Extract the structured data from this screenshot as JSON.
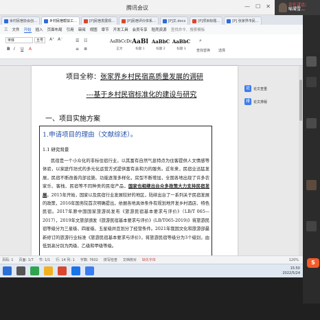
{
  "meeting": {
    "title": "腾讯会议",
    "share_status": "正在讲话：",
    "share_status_2": "喻凝雪…"
  },
  "doc_tabs": [
    {
      "label": "余村民宿协会创…"
    },
    {
      "label": "乡村民宿帮扶工…"
    },
    {
      "label": "[P]民宿发展现…"
    },
    {
      "label": "[P]民宿评价体系…"
    },
    {
      "label": "[P]文.docx"
    },
    {
      "label": "[P]项目标题…"
    },
    {
      "label": "[P] 张家界市民…"
    }
  ],
  "menu": [
    "三",
    "文件",
    "开始",
    "插入",
    "页面布局",
    "引用",
    "审阅",
    "视图",
    "章节",
    "开发工具",
    "会员专享",
    "稻壳资源",
    "查找命令、搜索模板"
  ],
  "menu_active": "开始",
  "toolbar": {
    "font_name": "宋体",
    "font_size": "五号",
    "styles": [
      {
        "sample": "AaBbCcDc",
        "label": "正文"
      },
      {
        "sample": "AaBl",
        "label": "标题 1"
      },
      {
        "sample": "AaBbC",
        "label": "标题 2"
      },
      {
        "sample": "AaBbC",
        "label": "标题 3"
      }
    ],
    "find_label": "查找替换",
    "select_label": "选择"
  },
  "side_panel": [
    {
      "icon": "论",
      "label": "论文查重"
    },
    {
      "icon": "排",
      "label": "论文排版"
    }
  ],
  "document": {
    "title_prefix": "项目全称：",
    "title_main": "张家界乡村民宿高质量发展的调研",
    "title_sub": "---基于乡村民宿标准化的建设与研究",
    "section_heading": "一、项目实施方案",
    "box_heading": "1.申请项目的理由（文献综述）。",
    "box_subheading": "1.1 研究背景",
    "para_part1": "民宿是一个小众化的非标住宿行业，以其富有自然气息特点为住客提供人文情感等体验，以家庭作坊式的多元化运营方式提供富有亲和力的服务。近年来，民宿业迅猛发展，民宿不断改善内部设施、功能逐渐多样化，房型不断增加，全国各地出现了许多农家乐、客栈、民宿等不同种类的民宿产品，",
    "para_bold": "国家也相继出台众多政策大力支持民宿发展",
    "para_part2": "。2015年开始，国家以及民宿行业发展较好的地区，陆续出台了一系列关于民宿发展的政策，2016年国务院首次明确提出，依据各地具体条件有规划地开发乡村酒店、特色民宿。2017年原中国国家旅游局发布《旅游民宿基本要求与评价》（LB/T 065—2017），2019年文旅部颁发《旅游民宿基本要求与评价》(LB/T065-2019)》将旅游民宿等级分为三星级、四星级、五星级并且划分了经营条件。2021年我国文化和旅游部最新修订的旅游行业标准《旅游民宿基本要求与评价》，将旅游民宿等级分为3个级别，由低到高分别为丙级、乙级和甲级等级。"
  },
  "status_bar": {
    "page": "页码: 1",
    "pages": "页面: 1/7",
    "section": "节: 1/1",
    "row": "行: 14 列: 1",
    "words": "字数: 7602",
    "spell": "拼写检查",
    "check": "文档校对",
    "missing_font": "缺失字体",
    "zoom": "120%"
  },
  "taskbar": {
    "time": "15:50",
    "date": "2022/5/24"
  }
}
